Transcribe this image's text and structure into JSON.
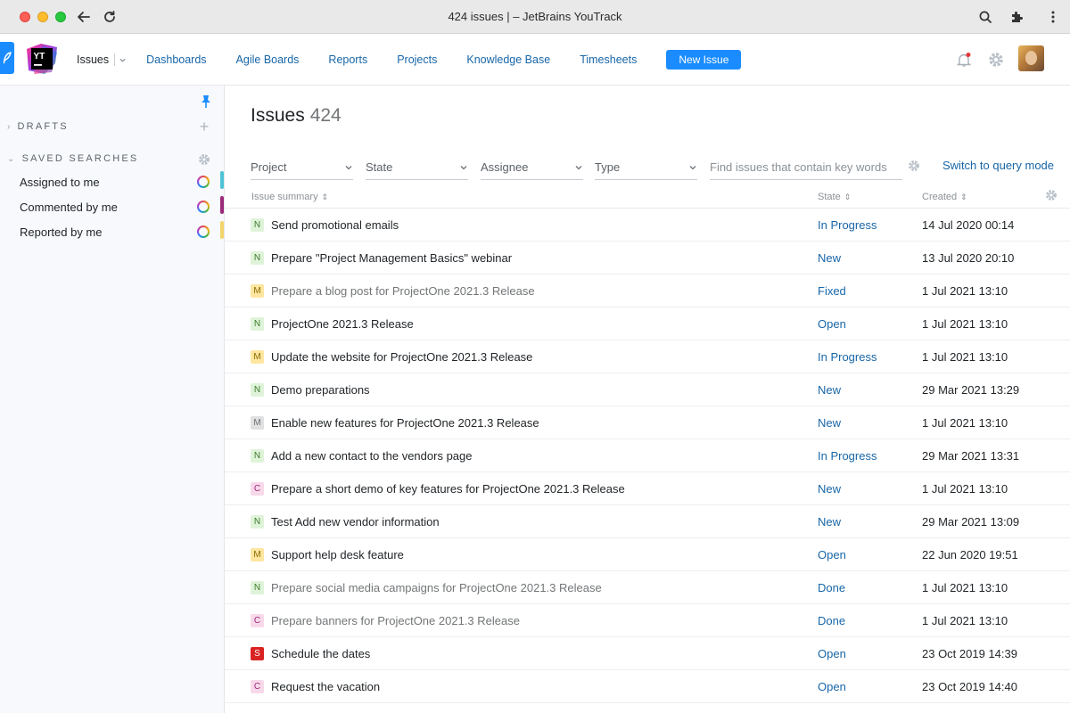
{
  "window": {
    "title": "424 issues | – JetBrains YouTrack"
  },
  "header": {
    "logo_text": "YT",
    "nav": {
      "issues": "Issues",
      "dashboards": "Dashboards",
      "agile_boards": "Agile Boards",
      "reports": "Reports",
      "projects": "Projects",
      "knowledge_base": "Knowledge Base",
      "timesheets": "Timesheets"
    },
    "new_issue": "New Issue",
    "icons": [
      "bell-icon",
      "gear-icon",
      "avatar"
    ]
  },
  "sidebar": {
    "drafts": "DRAFTS",
    "saved_searches": "SAVED SEARCHES",
    "items": [
      {
        "label": "Assigned to me",
        "color": "#4fc3d6"
      },
      {
        "label": "Commented by me",
        "color": "#9c2a7a"
      },
      {
        "label": "Reported by me",
        "color": "#f3d56b"
      }
    ]
  },
  "main": {
    "title": "Issues",
    "count": "424",
    "filters": {
      "project": "Project",
      "state": "State",
      "assignee": "Assignee",
      "type": "Type"
    },
    "search_placeholder": "Find issues that contain key words",
    "query_mode": "Switch to query mode",
    "columns": {
      "summary": "Issue summary",
      "state": "State",
      "created": "Created"
    },
    "issues": [
      {
        "priority": "N",
        "summary": "Send promotional emails",
        "state": "In Progress",
        "created": "14 Jul 2020 00:14",
        "resolved": false
      },
      {
        "priority": "N",
        "summary": "Prepare \"Project Management Basics\" webinar",
        "state": "New",
        "created": "13 Jul 2020 20:10",
        "resolved": false
      },
      {
        "priority": "M",
        "summary": "Prepare a blog post for ProjectOne 2021.3 Release",
        "state": "Fixed",
        "created": "1 Jul 2021 13:10",
        "resolved": true
      },
      {
        "priority": "N",
        "summary": "ProjectOne 2021.3 Release",
        "state": "Open",
        "created": "1 Jul 2021 13:10",
        "resolved": false
      },
      {
        "priority": "M",
        "summary": "Update the website for ProjectOne 2021.3 Release",
        "state": "In Progress",
        "created": "1 Jul 2021 13:10",
        "resolved": false
      },
      {
        "priority": "N",
        "summary": "Demo preparations",
        "state": "New",
        "created": "29 Mar 2021 13:29",
        "resolved": false
      },
      {
        "priority": "M",
        "summary": "Enable new features for ProjectOne 2021.3 Release",
        "state": "New",
        "created": "1 Jul 2021 13:10",
        "resolved": false
      },
      {
        "priority": "N",
        "summary": "Add a new contact to the vendors page",
        "state": "In Progress",
        "created": "29 Mar 2021 13:31",
        "resolved": false
      },
      {
        "priority": "C",
        "summary": "Prepare a short demo of key features for ProjectOne 2021.3 Release",
        "state": "New",
        "created": "1 Jul 2021 13:10",
        "resolved": false
      },
      {
        "priority": "N",
        "summary": "Test Add new vendor information",
        "state": "New",
        "created": "29 Mar 2021 13:09",
        "resolved": false
      },
      {
        "priority": "M",
        "summary": "Support help desk feature",
        "state": "Open",
        "created": "22 Jun 2020 19:51",
        "resolved": false
      },
      {
        "priority": "N",
        "summary": "Prepare social media campaigns for ProjectOne 2021.3 Release",
        "state": "Done",
        "created": "1 Jul 2021 13:10",
        "resolved": true
      },
      {
        "priority": "C",
        "summary": "Prepare banners for ProjectOne 2021.3 Release",
        "state": "Done",
        "created": "1 Jul 2021 13:10",
        "resolved": true
      },
      {
        "priority": "S",
        "summary": "Schedule the dates",
        "state": "Open",
        "created": "23 Oct 2019 14:39",
        "resolved": false
      },
      {
        "priority": "C",
        "summary": "Request the vacation",
        "state": "Open",
        "created": "23 Oct 2019 14:40",
        "resolved": false
      }
    ]
  },
  "colors": {
    "accent": "#1a8cff",
    "link": "#1866a7",
    "priority_N": "#dff3d9",
    "priority_M": "#fde6a0",
    "priority_M_gray": "#e0e0e0",
    "priority_C": "#f7d9ea",
    "priority_S": "#d92323"
  }
}
